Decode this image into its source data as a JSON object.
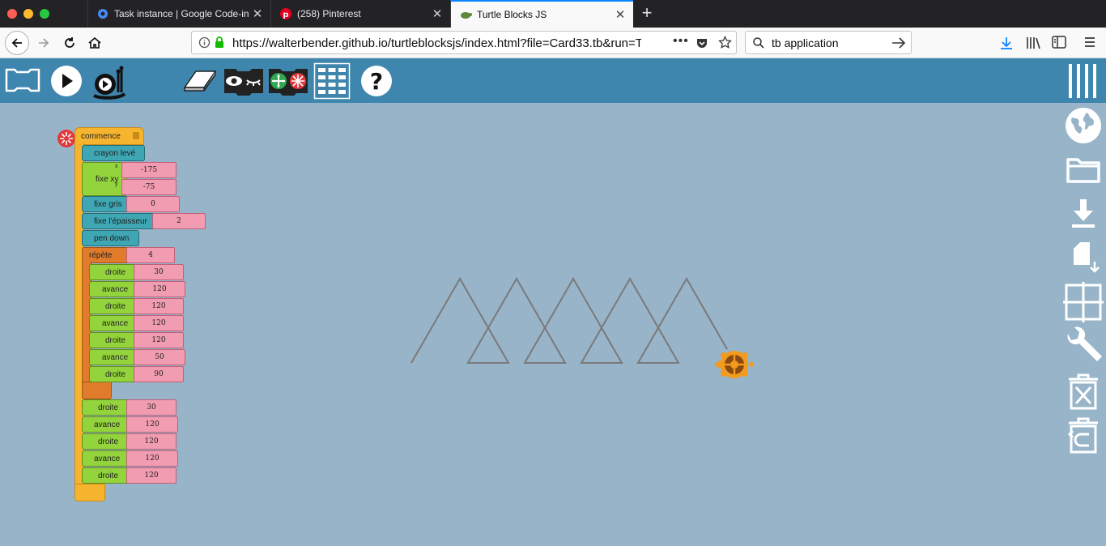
{
  "browser": {
    "tabs": [
      {
        "title": "Task instance | Google Code-in",
        "icon": "gear-icon"
      },
      {
        "title": "(258) Pinterest",
        "icon": "pinterest-icon"
      },
      {
        "title": "Turtle Blocks JS",
        "icon": "turtle-icon",
        "active": true
      }
    ],
    "url": "https://walterbender.github.io/turtleblocksjs/index.html?file=Card33.tb&run=T",
    "search_text": "tb application"
  },
  "toolbar": {
    "icons": [
      "blocks-toggle-icon",
      "run-icon",
      "slow-run-icon",
      "eraser-icon",
      "show-hide-icon",
      "collapse-expand-icon",
      "palette-grid-icon",
      "help-icon",
      "menu-bars-icon"
    ]
  },
  "right_palette": {
    "icons": [
      "globe-icon",
      "folder-icon",
      "download-icon",
      "save-stack-icon",
      "grid-icon",
      "wrench-icon",
      "delete-icon",
      "restore-trash-icon"
    ]
  },
  "program": {
    "start_label": "commence",
    "pen_up": "crayon levé",
    "setxy_label": "fixe xy",
    "x_label": "x",
    "y_label": "y",
    "x_value": "-175",
    "y_value": "-75",
    "setgrey_label": "fixe gris",
    "grey_value": "0",
    "pensize_label": "fixe l'épaisseur",
    "pensize_value": "2",
    "pen_down": "pen down",
    "repeat_label": "répète",
    "repeat_value": "4",
    "loop_body": [
      {
        "label": "droite",
        "value": "30"
      },
      {
        "label": "avance",
        "value": "120"
      },
      {
        "label": "droite",
        "value": "120"
      },
      {
        "label": "avance",
        "value": "120"
      },
      {
        "label": "droite",
        "value": "120"
      },
      {
        "label": "avance",
        "value": "50"
      },
      {
        "label": "droite",
        "value": "90"
      }
    ],
    "after_loop": [
      {
        "label": "droite",
        "value": "30"
      },
      {
        "label": "avance",
        "value": "120"
      },
      {
        "label": "droite",
        "value": "120"
      },
      {
        "label": "avance",
        "value": "120"
      },
      {
        "label": "droite",
        "value": "120"
      }
    ]
  },
  "colors": {
    "toolbar": "#3f86ae",
    "canvas": "#97b4c8",
    "pen": "#7a7a7a",
    "turtle": "#f39b1e"
  }
}
